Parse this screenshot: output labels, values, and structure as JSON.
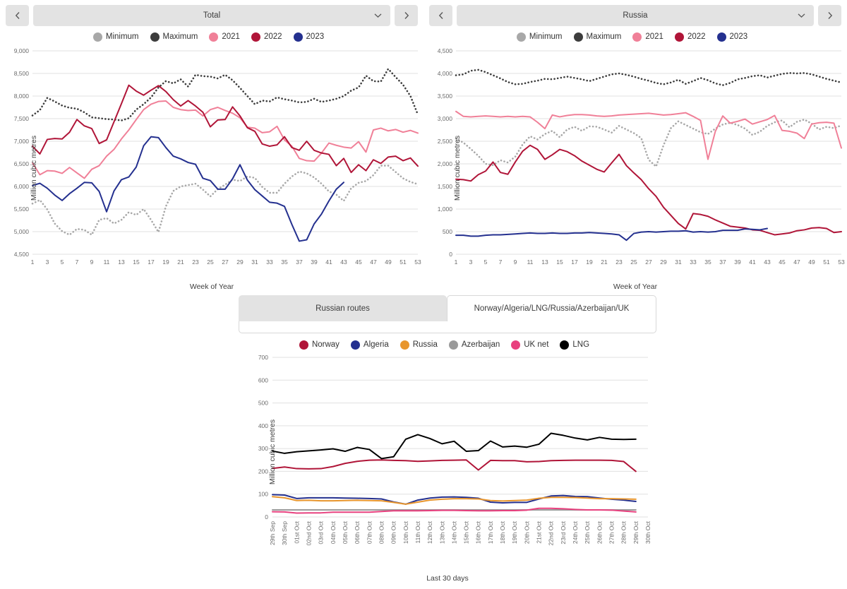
{
  "panels": [
    {
      "id": "total",
      "selector": {
        "prev_label": "‹",
        "next_label": "›",
        "value": "Total",
        "caret": "chevron-down-icon"
      },
      "chart_data": {
        "type": "line",
        "title": "Total",
        "xlabel": "Week of Year",
        "ylabel": "Million cubic metres",
        "ylim": [
          4500,
          9000
        ],
        "ystep": 500,
        "yticks": [
          "4,500",
          "5,000",
          "5,500",
          "6,000",
          "6,500",
          "7,000",
          "7,500",
          "8,000",
          "8,500",
          "9,000"
        ],
        "xlim": [
          1,
          53
        ],
        "xticks": [
          1,
          3,
          5,
          7,
          9,
          11,
          13,
          15,
          17,
          19,
          21,
          23,
          25,
          27,
          29,
          31,
          33,
          35,
          37,
          39,
          41,
          43,
          45,
          47,
          49,
          51,
          53
        ],
        "grid": true,
        "legend_position": "top",
        "series": [
          {
            "name": "Minimum",
            "color": "#a8a8a8",
            "style": "dotted",
            "values": [
              5620,
              5700,
              5490,
              5180,
              5010,
              4930,
              5060,
              5040,
              4930,
              5260,
              5300,
              5180,
              5260,
              5430,
              5370,
              5500,
              5260,
              4990,
              5560,
              5900,
              6000,
              6030,
              6060,
              5930,
              5780,
              5940,
              6040,
              6150,
              6120,
              6220,
              6190,
              5990,
              5860,
              5860,
              6060,
              6220,
              6330,
              6290,
              6200,
              6060,
              5890,
              5820,
              5680,
              5960,
              6080,
              6120,
              6250,
              6460,
              6460,
              6320,
              6180,
              6100,
              6050
            ]
          },
          {
            "name": "Maximum",
            "color": "#3d3d3d",
            "style": "dotted",
            "values": [
              7570,
              7690,
              7960,
              7880,
              7790,
              7740,
              7720,
              7640,
              7530,
              7510,
              7490,
              7480,
              7460,
              7510,
              7700,
              7820,
              7970,
              8190,
              8330,
              8280,
              8370,
              8210,
              8470,
              8440,
              8430,
              8390,
              8470,
              8350,
              8180,
              8000,
              7820,
              7900,
              7880,
              7970,
              7930,
              7900,
              7860,
              7870,
              7940,
              7870,
              7900,
              7940,
              8000,
              8120,
              8190,
              8450,
              8330,
              8320,
              8600,
              8420,
              8250,
              8000,
              7590
            ]
          },
          {
            "name": "2021",
            "color": "#f08098",
            "style": "solid",
            "values": [
              6520,
              6260,
              6350,
              6340,
              6290,
              6420,
              6300,
              6180,
              6380,
              6460,
              6670,
              6820,
              7050,
              7250,
              7480,
              7700,
              7820,
              7880,
              7890,
              7750,
              7700,
              7680,
              7690,
              7560,
              7700,
              7750,
              7680,
              7620,
              7520,
              7310,
              7290,
              7190,
              7210,
              7330,
              7030,
              6890,
              6620,
              6570,
              6560,
              6740,
              6960,
              6910,
              6870,
              6850,
              6990,
              6760,
              7250,
              7290,
              7230,
              7260,
              7200,
              7240,
              7180
            ]
          },
          {
            "name": "2022",
            "color": "#b01538",
            "style": "solid",
            "values": [
              6890,
              6720,
              7040,
              7060,
              7050,
              7200,
              7480,
              7340,
              7280,
              6950,
              7030,
              7430,
              7830,
              8240,
              8110,
              8020,
              8130,
              8230,
              8100,
              7920,
              7780,
              7900,
              7780,
              7640,
              7320,
              7470,
              7480,
              7760,
              7560,
              7300,
              7220,
              6940,
              6890,
              6920,
              7100,
              6860,
              6800,
              7000,
              6800,
              6740,
              6710,
              6460,
              6620,
              6310,
              6480,
              6350,
              6590,
              6510,
              6650,
              6670,
              6570,
              6630,
              6450
            ]
          },
          {
            "name": "2023",
            "color": "#24308f",
            "style": "solid",
            "values": [
              6020,
              6070,
              5960,
              5810,
              5690,
              5840,
              5960,
              6090,
              6080,
              5890,
              5440,
              5900,
              6150,
              6210,
              6430,
              6900,
              7100,
              7080,
              6860,
              6670,
              6610,
              6530,
              6490,
              6180,
              6130,
              5940,
              5940,
              6170,
              6480,
              6140,
              5930,
              5790,
              5650,
              5630,
              5560,
              5160,
              4790,
              4820,
              5170,
              5390,
              5680,
              5940,
              6090
            ]
          }
        ]
      }
    },
    {
      "id": "russia",
      "selector": {
        "prev_label": "‹",
        "next_label": "›",
        "value": "Russia",
        "caret": "chevron-down-icon"
      },
      "chart_data": {
        "type": "line",
        "title": "Russia",
        "xlabel": "Week of Year",
        "ylabel": "Million cubic metres",
        "ylim": [
          0,
          4500
        ],
        "ystep": 500,
        "yticks": [
          "0",
          "500",
          "1,000",
          "1,500",
          "2,000",
          "2,500",
          "3,000",
          "3,500",
          "4,000",
          "4,500"
        ],
        "xlim": [
          1,
          53
        ],
        "xticks": [
          1,
          3,
          5,
          7,
          9,
          11,
          13,
          15,
          17,
          19,
          21,
          23,
          25,
          27,
          29,
          31,
          33,
          35,
          37,
          39,
          41,
          43,
          45,
          47,
          49,
          51,
          53
        ],
        "grid": true,
        "legend_position": "top",
        "series": [
          {
            "name": "Minimum",
            "color": "#a8a8a8",
            "style": "dotted",
            "values": [
              2560,
              2470,
              2330,
              2180,
              2000,
              1970,
              2080,
              2030,
              2160,
              2430,
              2610,
              2540,
              2660,
              2730,
              2590,
              2760,
              2820,
              2730,
              2830,
              2820,
              2760,
              2690,
              2840,
              2760,
              2680,
              2570,
              2090,
              1940,
              2410,
              2790,
              2940,
              2860,
              2780,
              2700,
              2660,
              2780,
              2870,
              2910,
              2860,
              2780,
              2640,
              2710,
              2840,
              2920,
              2960,
              2810,
              2930,
              2980,
              2890,
              2760,
              2820,
              2790,
              2850
            ]
          },
          {
            "name": "Maximum",
            "color": "#3d3d3d",
            "style": "dotted",
            "values": [
              3960,
              3980,
              4060,
              4080,
              4030,
              3960,
              3890,
              3810,
              3760,
              3770,
              3810,
              3840,
              3880,
              3870,
              3900,
              3930,
              3900,
              3870,
              3830,
              3880,
              3930,
              3980,
              4000,
              3970,
              3930,
              3880,
              3840,
              3790,
              3760,
              3800,
              3860,
              3770,
              3830,
              3900,
              3850,
              3780,
              3740,
              3790,
              3870,
              3900,
              3940,
              3960,
              3910,
              3950,
              3990,
              4010,
              4000,
              4010,
              3980,
              3930,
              3880,
              3840,
              3800
            ]
          },
          {
            "name": "2021",
            "color": "#f08098",
            "style": "solid",
            "values": [
              3160,
              3050,
              3040,
              3050,
              3060,
              3050,
              3040,
              3050,
              3040,
              3050,
              3040,
              2920,
              2780,
              3080,
              3040,
              3070,
              3090,
              3090,
              3080,
              3060,
              3050,
              3060,
              3080,
              3090,
              3100,
              3110,
              3120,
              3100,
              3080,
              3090,
              3110,
              3130,
              3050,
              2960,
              2100,
              2720,
              3060,
              2900,
              2940,
              2990,
              2880,
              2930,
              2980,
              3070,
              2740,
              2720,
              2680,
              2560,
              2880,
              2910,
              2920,
              2900,
              2350
            ]
          },
          {
            "name": "2022",
            "color": "#b01538",
            "style": "solid",
            "values": [
              1660,
              1650,
              1620,
              1760,
              1840,
              2040,
              1810,
              1770,
              2040,
              2280,
              2410,
              2320,
              2100,
              2200,
              2320,
              2270,
              2180,
              2060,
              1970,
              1880,
              1820,
              2020,
              2210,
              1960,
              1800,
              1650,
              1450,
              1280,
              1040,
              860,
              680,
              560,
              900,
              880,
              840,
              760,
              690,
              620,
              600,
              580,
              540,
              530,
              480,
              430,
              450,
              470,
              520,
              540,
              580,
              590,
              570,
              480,
              500
            ]
          },
          {
            "name": "2023",
            "color": "#24308f",
            "style": "solid",
            "values": [
              420,
              420,
              400,
              400,
              420,
              430,
              430,
              440,
              450,
              460,
              470,
              460,
              460,
              470,
              460,
              460,
              470,
              470,
              480,
              470,
              460,
              450,
              430,
              310,
              460,
              490,
              500,
              490,
              500,
              510,
              510,
              520,
              490,
              500,
              490,
              500,
              530,
              530,
              530,
              560,
              550,
              540,
              570
            ]
          }
        ]
      }
    }
  ],
  "bottom": {
    "tabs": [
      {
        "label": "Russian routes",
        "active": false
      },
      {
        "label": "Norway/Algeria/LNG/Russia/Azerbaijan/UK",
        "active": true
      }
    ],
    "chart_data": {
      "type": "line",
      "xlabel": "Last 30 days",
      "ylabel": "Million cubic metres",
      "ylim": [
        0,
        700
      ],
      "ystep": 100,
      "yticks": [
        "0",
        "100",
        "200",
        "300",
        "400",
        "500",
        "600",
        "700"
      ],
      "grid": true,
      "legend_position": "top",
      "categories": [
        "29th Sep",
        "30th Sep",
        "01st Oct",
        "02nd Oct",
        "03rd Oct",
        "04th Oct",
        "05th Oct",
        "06th Oct",
        "07th Oct",
        "08th Oct",
        "09th Oct",
        "10th Oct",
        "11th Oct",
        "12th Oct",
        "13th Oct",
        "14th Oct",
        "15th Oct",
        "16th Oct",
        "17th Oct",
        "18th Oct",
        "19th Oct",
        "20th Oct",
        "21st Oct",
        "22nd Oct",
        "23rd Oct",
        "24th Oct",
        "25th Oct",
        "26th Oct",
        "27th Oct",
        "28th Oct",
        "29th Oct",
        "30th Oct"
      ],
      "series": [
        {
          "name": "Norway",
          "color": "#b01538",
          "style": "solid",
          "values": [
            213,
            219,
            212,
            211,
            212,
            221,
            235,
            244,
            249,
            250,
            248,
            247,
            244,
            246,
            248,
            249,
            250,
            206,
            248,
            247,
            247,
            242,
            243,
            247,
            248,
            249,
            249,
            249,
            248,
            243,
            200
          ]
        },
        {
          "name": "Algeria",
          "color": "#24308f",
          "style": "solid",
          "values": [
            98,
            96,
            81,
            84,
            84,
            84,
            83,
            82,
            81,
            79,
            66,
            56,
            74,
            83,
            87,
            88,
            86,
            82,
            65,
            62,
            64,
            64,
            79,
            92,
            94,
            90,
            89,
            83,
            78,
            74,
            68
          ]
        },
        {
          "name": "Russia",
          "color": "#e8962e",
          "style": "solid",
          "values": [
            89,
            84,
            72,
            73,
            71,
            71,
            72,
            73,
            72,
            71,
            64,
            56,
            65,
            74,
            78,
            80,
            80,
            79,
            72,
            70,
            72,
            74,
            82,
            86,
            86,
            85,
            83,
            80,
            80,
            79,
            78
          ]
        },
        {
          "name": "Azerbaijan",
          "color": "#9a9a9a",
          "style": "solid",
          "values": [
            31,
            31,
            31,
            31,
            31,
            31,
            31,
            31,
            31,
            31,
            31,
            31,
            31,
            31,
            31,
            31,
            31,
            31,
            31,
            31,
            31,
            31,
            31,
            31,
            31,
            31,
            31,
            31,
            31,
            31,
            31
          ]
        },
        {
          "name": "UK net",
          "color": "#e8417f",
          "style": "solid",
          "values": [
            23,
            22,
            17,
            18,
            18,
            21,
            21,
            21,
            21,
            24,
            27,
            27,
            27,
            28,
            29,
            29,
            28,
            27,
            27,
            28,
            28,
            30,
            38,
            38,
            36,
            33,
            31,
            31,
            30,
            26,
            22
          ]
        },
        {
          "name": "LNG",
          "color": "#000000",
          "style": "solid",
          "values": [
            289,
            279,
            286,
            290,
            294,
            299,
            288,
            305,
            296,
            256,
            264,
            341,
            361,
            344,
            321,
            332,
            288,
            291,
            333,
            307,
            311,
            306,
            319,
            367,
            358,
            346,
            338,
            349,
            341,
            340,
            341
          ]
        }
      ]
    }
  }
}
